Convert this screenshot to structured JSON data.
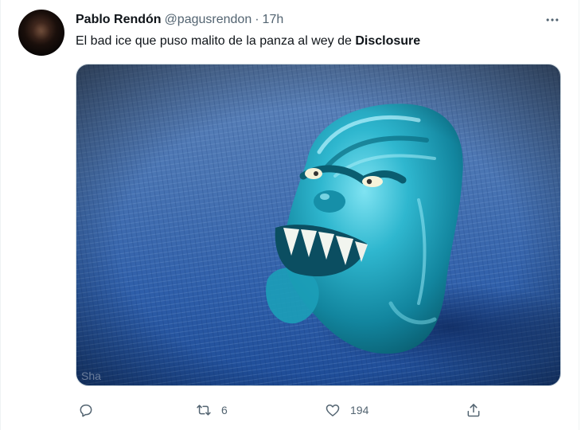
{
  "tweet": {
    "author_name": "Pablo Rendón",
    "author_handle": "@pagusrendon",
    "separator": "·",
    "time": "17h",
    "text_plain": "El bad ice que puso malito de la panza al wey de ",
    "text_bold": "Disclosure"
  },
  "media": {
    "watermark": "Sha"
  },
  "actions": {
    "reply_count": "",
    "retweet_count": "6",
    "like_count": "194"
  },
  "icons": {
    "more": "more-horizontal-icon",
    "reply": "reply-icon",
    "retweet": "retweet-icon",
    "like": "heart-icon",
    "share": "share-icon"
  },
  "colors": {
    "text_primary": "#0f1419",
    "text_secondary": "#536471",
    "divider": "#eff3f4"
  }
}
